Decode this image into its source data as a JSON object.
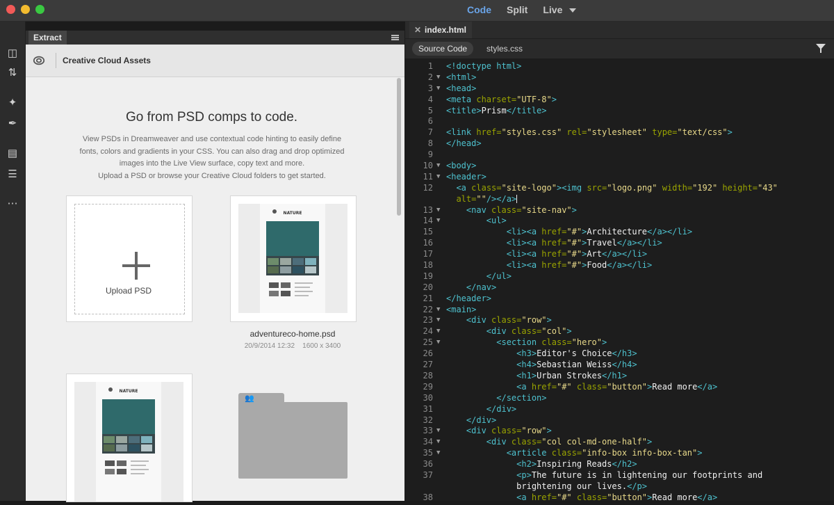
{
  "titlebar": {
    "views": [
      "Code",
      "Split",
      "Live"
    ]
  },
  "left_panel": {
    "tab_label": "Extract",
    "cc_title": "Creative Cloud Assets",
    "headline": "Go from PSD comps to code.",
    "description_lines": [
      "View PSDs in Dreamweaver and use contextual code hinting to easily define",
      "fonts, colors and gradients in your CSS. You can also drag and drop optimized",
      "images into the Live View surface, copy text and more.",
      "Upload a PSD or browse your Creative Cloud folders to get started."
    ],
    "upload_label": "Upload PSD",
    "file": {
      "name": "adventureco-home.psd",
      "date": "20/9/2014 12:32",
      "dimensions": "1600 x 3400"
    },
    "thumbnail_brand": "NATURE"
  },
  "editor": {
    "file_tab": "index.html",
    "source_label": "Source Code",
    "styles_label": "styles.css",
    "lines": [
      {
        "n": "1",
        "fold": "",
        "indent": "",
        "parts": [
          [
            "tag",
            "<!doctype html>"
          ]
        ]
      },
      {
        "n": "2",
        "fold": "▼",
        "indent": "",
        "parts": [
          [
            "tag",
            "<html>"
          ]
        ]
      },
      {
        "n": "3",
        "fold": "▼",
        "indent": "",
        "parts": [
          [
            "tag",
            "<head>"
          ]
        ]
      },
      {
        "n": "4",
        "fold": "",
        "indent": "",
        "parts": [
          [
            "tag",
            "<meta "
          ],
          [
            "attr",
            "charset="
          ],
          [
            "val",
            "\"UTF-8\""
          ],
          [
            "tag",
            ">"
          ]
        ]
      },
      {
        "n": "5",
        "fold": "",
        "indent": "",
        "parts": [
          [
            "tag",
            "<title>"
          ],
          [
            "txt",
            "Prism"
          ],
          [
            "tag",
            "</title>"
          ]
        ]
      },
      {
        "n": "6",
        "fold": "",
        "indent": "",
        "parts": []
      },
      {
        "n": "7",
        "fold": "",
        "indent": "",
        "parts": [
          [
            "tag",
            "<link "
          ],
          [
            "attr",
            "href="
          ],
          [
            "val",
            "\"styles.css\""
          ],
          [
            "attr",
            " rel="
          ],
          [
            "val",
            "\"stylesheet\""
          ],
          [
            "attr",
            " type="
          ],
          [
            "val",
            "\"text/css\""
          ],
          [
            "tag",
            ">"
          ]
        ]
      },
      {
        "n": "8",
        "fold": "",
        "indent": "",
        "parts": [
          [
            "tag",
            "</head>"
          ]
        ]
      },
      {
        "n": "9",
        "fold": "",
        "indent": "",
        "parts": []
      },
      {
        "n": "10",
        "fold": "▼",
        "indent": "",
        "parts": [
          [
            "tag",
            "<body>"
          ]
        ]
      },
      {
        "n": "11",
        "fold": "▼",
        "indent": "",
        "parts": [
          [
            "tag",
            "<header>"
          ]
        ]
      },
      {
        "n": "12",
        "fold": "",
        "indent": "  ",
        "parts": [
          [
            "tag",
            "<a "
          ],
          [
            "attr",
            "class="
          ],
          [
            "val",
            "\"site-logo\""
          ],
          [
            "tag",
            "><img "
          ],
          [
            "attr",
            "src="
          ],
          [
            "val",
            "\"logo.png\""
          ],
          [
            "attr",
            " width="
          ],
          [
            "val",
            "\"192\""
          ],
          [
            "attr",
            " height="
          ],
          [
            "val",
            "\"43\""
          ]
        ]
      },
      {
        "n": "",
        "fold": "",
        "indent": "  ",
        "parts": [
          [
            "attr",
            "alt="
          ],
          [
            "val",
            "\"\""
          ],
          [
            "tag",
            "/></a>"
          ],
          [
            "cursor",
            ""
          ]
        ]
      },
      {
        "n": "13",
        "fold": "▼",
        "indent": "    ",
        "parts": [
          [
            "tag",
            "<nav "
          ],
          [
            "attr",
            "class="
          ],
          [
            "val",
            "\"site-nav\""
          ],
          [
            "tag",
            ">"
          ]
        ]
      },
      {
        "n": "14",
        "fold": "▼",
        "indent": "        ",
        "parts": [
          [
            "tag",
            "<ul>"
          ]
        ]
      },
      {
        "n": "15",
        "fold": "",
        "indent": "            ",
        "parts": [
          [
            "tag",
            "<li><a "
          ],
          [
            "attr",
            "href="
          ],
          [
            "val",
            "\"#\""
          ],
          [
            "tag",
            ">"
          ],
          [
            "txt",
            "Architecture"
          ],
          [
            "tag",
            "</a></li>"
          ]
        ]
      },
      {
        "n": "16",
        "fold": "",
        "indent": "            ",
        "parts": [
          [
            "tag",
            "<li><a "
          ],
          [
            "attr",
            "href="
          ],
          [
            "val",
            "\"#\""
          ],
          [
            "tag",
            ">"
          ],
          [
            "txt",
            "Travel"
          ],
          [
            "tag",
            "</a></li>"
          ]
        ]
      },
      {
        "n": "17",
        "fold": "",
        "indent": "            ",
        "parts": [
          [
            "tag",
            "<li><a "
          ],
          [
            "attr",
            "href="
          ],
          [
            "val",
            "\"#\""
          ],
          [
            "tag",
            ">"
          ],
          [
            "txt",
            "Art"
          ],
          [
            "tag",
            "</a></li>"
          ]
        ]
      },
      {
        "n": "18",
        "fold": "",
        "indent": "            ",
        "parts": [
          [
            "tag",
            "<li><a "
          ],
          [
            "attr",
            "href="
          ],
          [
            "val",
            "\"#\""
          ],
          [
            "tag",
            ">"
          ],
          [
            "txt",
            "Food"
          ],
          [
            "tag",
            "</a></li>"
          ]
        ]
      },
      {
        "n": "19",
        "fold": "",
        "indent": "        ",
        "parts": [
          [
            "tag",
            "</ul>"
          ]
        ]
      },
      {
        "n": "20",
        "fold": "",
        "indent": "    ",
        "parts": [
          [
            "tag",
            "</nav>"
          ]
        ]
      },
      {
        "n": "21",
        "fold": "",
        "indent": "",
        "parts": [
          [
            "tag",
            "</header>"
          ]
        ]
      },
      {
        "n": "22",
        "fold": "▼",
        "indent": "",
        "parts": [
          [
            "tag",
            "<main>"
          ]
        ]
      },
      {
        "n": "23",
        "fold": "▼",
        "indent": "    ",
        "parts": [
          [
            "tag",
            "<div "
          ],
          [
            "attr",
            "class="
          ],
          [
            "val",
            "\"row\""
          ],
          [
            "tag",
            ">"
          ]
        ]
      },
      {
        "n": "24",
        "fold": "▼",
        "indent": "        ",
        "parts": [
          [
            "tag",
            "<div "
          ],
          [
            "attr",
            "class="
          ],
          [
            "val",
            "\"col\""
          ],
          [
            "tag",
            ">"
          ]
        ]
      },
      {
        "n": "25",
        "fold": "▼",
        "indent": "          ",
        "parts": [
          [
            "tag",
            "<section "
          ],
          [
            "attr",
            "class="
          ],
          [
            "val",
            "\"hero\""
          ],
          [
            "tag",
            ">"
          ]
        ]
      },
      {
        "n": "26",
        "fold": "",
        "indent": "              ",
        "parts": [
          [
            "tag",
            "<h3>"
          ],
          [
            "txt",
            "Editor's Choice"
          ],
          [
            "tag",
            "</h3>"
          ]
        ]
      },
      {
        "n": "27",
        "fold": "",
        "indent": "              ",
        "parts": [
          [
            "tag",
            "<h4>"
          ],
          [
            "txt",
            "Sebastian Weiss"
          ],
          [
            "tag",
            "</h4>"
          ]
        ]
      },
      {
        "n": "28",
        "fold": "",
        "indent": "              ",
        "parts": [
          [
            "tag",
            "<h1>"
          ],
          [
            "txt",
            "Urban Strokes"
          ],
          [
            "tag",
            "</h1>"
          ]
        ]
      },
      {
        "n": "29",
        "fold": "",
        "indent": "              ",
        "parts": [
          [
            "tag",
            "<a "
          ],
          [
            "attr",
            "href="
          ],
          [
            "val",
            "\"#\""
          ],
          [
            "attr",
            " class="
          ],
          [
            "val",
            "\"button\""
          ],
          [
            "tag",
            ">"
          ],
          [
            "txt",
            "Read more"
          ],
          [
            "tag",
            "</a>"
          ]
        ]
      },
      {
        "n": "30",
        "fold": "",
        "indent": "          ",
        "parts": [
          [
            "tag",
            "</section>"
          ]
        ]
      },
      {
        "n": "31",
        "fold": "",
        "indent": "        ",
        "parts": [
          [
            "tag",
            "</div>"
          ]
        ]
      },
      {
        "n": "32",
        "fold": "",
        "indent": "    ",
        "parts": [
          [
            "tag",
            "</div>"
          ]
        ]
      },
      {
        "n": "33",
        "fold": "▼",
        "indent": "    ",
        "parts": [
          [
            "tag",
            "<div "
          ],
          [
            "attr",
            "class="
          ],
          [
            "val",
            "\"row\""
          ],
          [
            "tag",
            ">"
          ]
        ]
      },
      {
        "n": "34",
        "fold": "▼",
        "indent": "        ",
        "parts": [
          [
            "tag",
            "<div "
          ],
          [
            "attr",
            "class="
          ],
          [
            "val",
            "\"col col-md-one-half\""
          ],
          [
            "tag",
            ">"
          ]
        ]
      },
      {
        "n": "35",
        "fold": "▼",
        "indent": "            ",
        "parts": [
          [
            "tag",
            "<article "
          ],
          [
            "attr",
            "class="
          ],
          [
            "val",
            "\"info-box info-box-tan\""
          ],
          [
            "tag",
            ">"
          ]
        ]
      },
      {
        "n": "36",
        "fold": "",
        "indent": "              ",
        "parts": [
          [
            "tag",
            "<h2>"
          ],
          [
            "txt",
            "Inspiring Reads"
          ],
          [
            "tag",
            "</h2>"
          ]
        ]
      },
      {
        "n": "37",
        "fold": "",
        "indent": "              ",
        "parts": [
          [
            "tag",
            "<p>"
          ],
          [
            "txt",
            "The future is in lightening our footprints and"
          ]
        ]
      },
      {
        "n": "",
        "fold": "",
        "indent": "              ",
        "parts": [
          [
            "txt",
            "brightening our lives."
          ],
          [
            "tag",
            "</p>"
          ]
        ]
      },
      {
        "n": "38",
        "fold": "",
        "indent": "              ",
        "parts": [
          [
            "tag",
            "<a "
          ],
          [
            "attr",
            "href="
          ],
          [
            "val",
            "\"#\""
          ],
          [
            "attr",
            " class="
          ],
          [
            "val",
            "\"button\""
          ],
          [
            "tag",
            ">"
          ],
          [
            "txt",
            "Read more"
          ],
          [
            "tag",
            "</a>"
          ]
        ]
      }
    ]
  }
}
